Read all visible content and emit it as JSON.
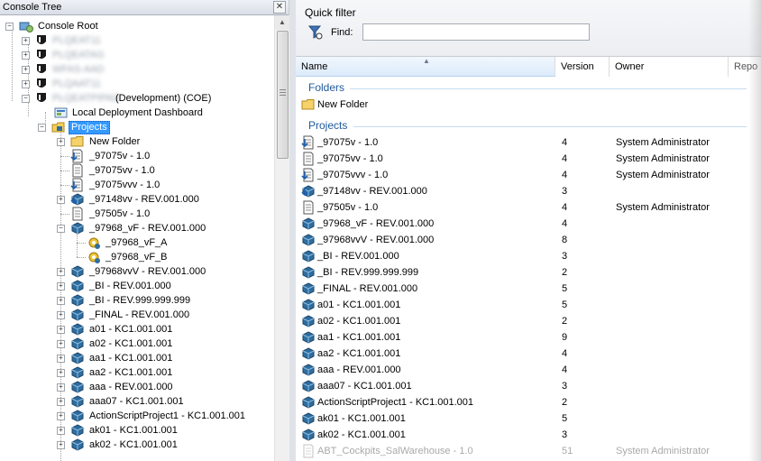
{
  "console_tree": {
    "title": "Console Tree",
    "close_glyph": "✕",
    "root": "Console Root",
    "servers": [
      "PLQEAT11",
      "PLQEATAG",
      "WFAS-AAD",
      "PLQAAT11"
    ],
    "active_server": "PLQEATPIPAD",
    "active_server_suffix": "(Development) (COE)",
    "dashboard": "Local Deployment Dashboard",
    "projects_label": "Projects",
    "nodes": [
      {
        "label": "New Folder",
        "icon": "folder-icon"
      },
      {
        "label": "_97075v - 1.0",
        "icon": "document-arrow-icon"
      },
      {
        "label": "_97075vv - 1.0",
        "icon": "document-icon"
      },
      {
        "label": "_97075vvv - 1.0",
        "icon": "document-arrow-icon"
      },
      {
        "label": "_97148vv - REV.001.000",
        "icon": "blue-cube-arrow-icon"
      },
      {
        "label": "_97505v - 1.0",
        "icon": "document-icon"
      },
      {
        "label": "_97968_vF - REV.001.000",
        "icon": "blue-cube-icon"
      },
      {
        "label": "_97968_vF_A",
        "icon": "yellow-gear-icon"
      },
      {
        "label": "_97968_vF_B",
        "icon": "yellow-gear-icon"
      },
      {
        "label": "_97968vvV - REV.001.000",
        "icon": "blue-cube-icon"
      },
      {
        "label": "_BI - REV.001.000",
        "icon": "blue-cube-icon"
      },
      {
        "label": "_BI - REV.999.999.999",
        "icon": "blue-cube-icon"
      },
      {
        "label": "_FINAL - REV.001.000",
        "icon": "blue-cube-icon"
      },
      {
        "label": "a01 - KC1.001.001",
        "icon": "blue-cube-icon"
      },
      {
        "label": "a02 - KC1.001.001",
        "icon": "blue-cube-icon"
      },
      {
        "label": "aa1 - KC1.001.001",
        "icon": "blue-cube-icon"
      },
      {
        "label": "aa2 - KC1.001.001",
        "icon": "blue-cube-icon"
      },
      {
        "label": "aaa - REV.001.000",
        "icon": "blue-cube-icon"
      },
      {
        "label": "aaa07 - KC1.001.001",
        "icon": "blue-cube-icon"
      },
      {
        "label": "ActionScriptProject1 - KC1.001.001",
        "icon": "blue-cube-icon"
      },
      {
        "label": "ak01 - KC1.001.001",
        "icon": "blue-cube-icon"
      },
      {
        "label": "ak02 - KC1.001.001",
        "icon": "blue-cube-icon"
      }
    ]
  },
  "quick_filter": {
    "title": "Quick filter",
    "find_label": "Find:",
    "find_value": ""
  },
  "list": {
    "columns": [
      "Name",
      "Version",
      "Owner",
      "Repo"
    ],
    "folders_group": "Folders",
    "folder": "New Folder",
    "projects_group": "Projects",
    "rows": [
      {
        "name": "_97075v - 1.0",
        "version": "4",
        "owner": "System Administrator",
        "icon": "document-arrow-icon"
      },
      {
        "name": "_97075vv - 1.0",
        "version": "4",
        "owner": "System Administrator",
        "icon": "document-icon"
      },
      {
        "name": "_97075vvv - 1.0",
        "version": "4",
        "owner": "System Administrator",
        "icon": "document-arrow-icon"
      },
      {
        "name": "_97148vv - REV.001.000",
        "version": "3",
        "owner": "",
        "icon": "blue-cube-arrow-icon"
      },
      {
        "name": "_97505v - 1.0",
        "version": "4",
        "owner": "System Administrator",
        "icon": "document-icon"
      },
      {
        "name": "_97968_vF - REV.001.000",
        "version": "4",
        "owner": "",
        "icon": "blue-cube-icon"
      },
      {
        "name": "_97968vvV - REV.001.000",
        "version": "8",
        "owner": "",
        "icon": "blue-cube-icon"
      },
      {
        "name": "_BI - REV.001.000",
        "version": "3",
        "owner": "",
        "icon": "blue-cube-icon"
      },
      {
        "name": "_BI - REV.999.999.999",
        "version": "2",
        "owner": "",
        "icon": "blue-cube-icon"
      },
      {
        "name": "_FINAL - REV.001.000",
        "version": "5",
        "owner": "",
        "icon": "blue-cube-icon"
      },
      {
        "name": "a01 - KC1.001.001",
        "version": "5",
        "owner": "",
        "icon": "blue-cube-icon"
      },
      {
        "name": "a02 - KC1.001.001",
        "version": "2",
        "owner": "",
        "icon": "blue-cube-icon"
      },
      {
        "name": "aa1 - KC1.001.001",
        "version": "9",
        "owner": "",
        "icon": "blue-cube-icon"
      },
      {
        "name": "aa2 - KC1.001.001",
        "version": "4",
        "owner": "",
        "icon": "blue-cube-icon"
      },
      {
        "name": "aaa - REV.001.000",
        "version": "4",
        "owner": "",
        "icon": "blue-cube-icon"
      },
      {
        "name": "aaa07 - KC1.001.001",
        "version": "3",
        "owner": "",
        "icon": "blue-cube-icon"
      },
      {
        "name": "ActionScriptProject1 - KC1.001.001",
        "version": "2",
        "owner": "",
        "icon": "blue-cube-icon"
      },
      {
        "name": "ak01 - KC1.001.001",
        "version": "5",
        "owner": "",
        "icon": "blue-cube-icon"
      },
      {
        "name": "ak02 - KC1.001.001",
        "version": "3",
        "owner": "",
        "icon": "blue-cube-icon"
      },
      {
        "name": "ABT_Cockpits_SalWarehouse - 1.0",
        "version": "51",
        "owner": "System Administrator",
        "icon": "document-icon"
      }
    ]
  },
  "colors": {
    "selection": "#3399ff",
    "group_text": "#1e5a9c",
    "cube": "#2f6d9e"
  }
}
